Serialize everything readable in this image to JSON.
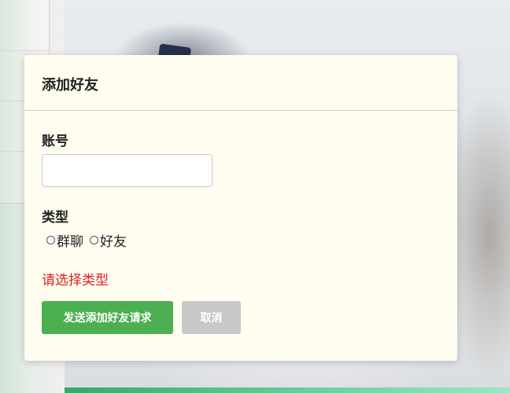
{
  "dialog": {
    "title": "添加好友",
    "account_label": "账号",
    "account_value": "",
    "account_placeholder": "",
    "type_label": "类型",
    "type_options": [
      {
        "label": "群聊",
        "selected": false
      },
      {
        "label": "好友",
        "selected": false
      }
    ],
    "error_message": "请选择类型",
    "submit_label": "发送添加好友请求",
    "cancel_label": "取消"
  },
  "colors": {
    "dialog_background": "#fffdf0",
    "primary_button": "#4caf50",
    "cancel_button": "#c8c8c8",
    "error_text": "#e02020"
  }
}
